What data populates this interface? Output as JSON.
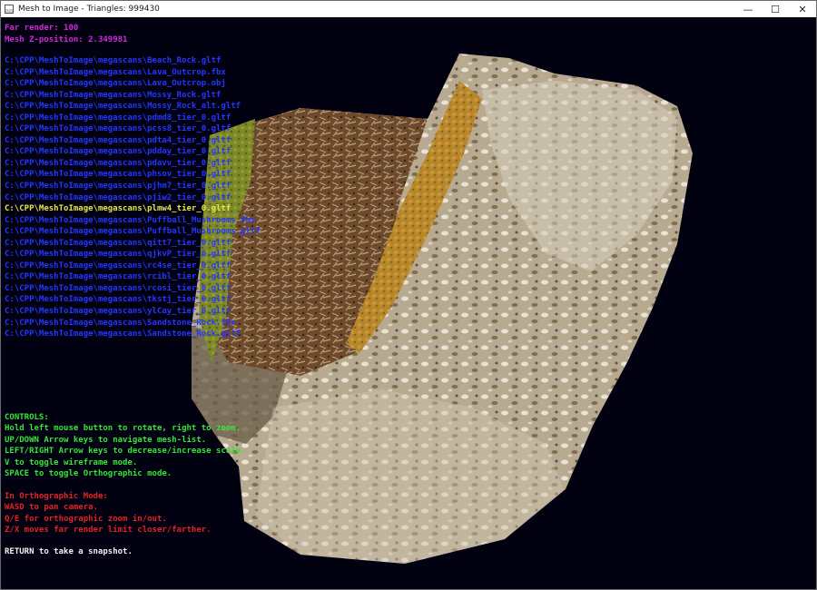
{
  "window": {
    "title": "Mesh to Image  -  Triangles: 999430",
    "minimize_glyph": "—",
    "maximize_glyph": "☐",
    "close_glyph": "✕"
  },
  "status": {
    "far_render": "Far render: 100",
    "mesh_z": "Mesh Z-position: 2.349981"
  },
  "mesh_list": [
    "C:\\CPP\\MeshToImage\\megascans\\Beach_Rock.gltf",
    "C:\\CPP\\MeshToImage\\megascans\\Lava_Outcrop.fbx",
    "C:\\CPP\\MeshToImage\\megascans\\Lava_Outcrop.obj",
    "C:\\CPP\\MeshToImage\\megascans\\Mossy_Rock.gltf",
    "C:\\CPP\\MeshToImage\\megascans\\Mossy_Rock_alt.gltf",
    "C:\\CPP\\MeshToImage\\megascans\\pdmd8_tier_0.gltf",
    "C:\\CPP\\MeshToImage\\megascans\\pcss8_tier_0.gltf",
    "C:\\CPP\\MeshToImage\\megascans\\pdta4_tier_0.gltf",
    "C:\\CPP\\MeshToImage\\megascans\\pdday_tier_0.gltf",
    "C:\\CPP\\MeshToImage\\megascans\\pdavv_tier_0.gltf",
    "C:\\CPP\\MeshToImage\\megascans\\phsov_tier_0.gltf",
    "C:\\CPP\\MeshToImage\\megascans\\pjhm7_tier_0.gltf",
    "C:\\CPP\\MeshToImage\\megascans\\pjiw2_tier_0.gltf",
    "C:\\CPP\\MeshToImage\\megascans\\plmw4_tier_0.gltf",
    "C:\\CPP\\MeshToImage\\megascans\\Puffball_Mushrooms.fbx",
    "C:\\CPP\\MeshToImage\\megascans\\Puffball_Mushrooms.gltf",
    "C:\\CPP\\MeshToImage\\megascans\\qitt7_tier_0.gltf",
    "C:\\CPP\\MeshToImage\\megascans\\qjkvP_tier_0.gltf",
    "C:\\CPP\\MeshToImage\\megascans\\rc4se_tier_0.gltf",
    "C:\\CPP\\MeshToImage\\megascans\\rcibl_tier_0.gltf",
    "C:\\CPP\\MeshToImage\\megascans\\rcosi_tier_0.gltf",
    "C:\\CPP\\MeshToImage\\megascans\\tkstj_tier_0.gltf",
    "C:\\CPP\\MeshToImage\\megascans\\ylCay_tier_0.gltf",
    "C:\\CPP\\MeshToImage\\megascans\\Sandstone_Rock.fbx",
    "C:\\CPP\\MeshToImage\\megascans\\Sandstone_Rock.gltf"
  ],
  "selected_index": 13,
  "controls": [
    "CONTROLS:",
    "Hold left mouse button to rotate, right to zoom.",
    "UP/DOWN Arrow keys to navigate mesh-list.",
    "LEFT/RIGHT Arrow keys to decrease/increase scale.",
    "V to toggle wireframe mode.",
    "SPACE to toggle Orthographic mode."
  ],
  "orthographic": [
    "In Orthographic Mode:",
    "WASD to pan camera.",
    "Q/E for orthographic zoom in/out.",
    "Z/X moves far render limit closer/farther."
  ],
  "snapshot_hint": "RETURN to take a snapshot.",
  "colors": {
    "background": "#010111",
    "status": "#d22bd6",
    "list": "#2536ff",
    "selected": "#e6e64a",
    "controls": "#35e635",
    "orthographic": "#e62222",
    "snapshot": "#f2f2f2"
  }
}
